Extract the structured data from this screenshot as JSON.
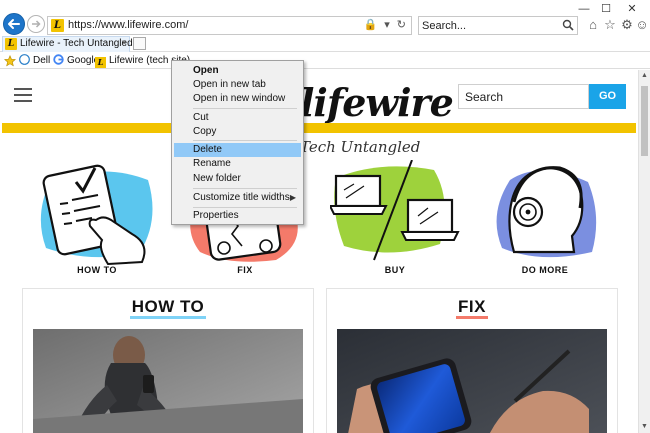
{
  "browser": {
    "url": "https://www.lifewire.com/",
    "search_placeholder": "Search...",
    "tab_title": "Lifewire - Tech Untangled",
    "tab_close": "×",
    "favicon_letter": "L",
    "window_controls": {
      "minimize": "—",
      "maximize": "☐",
      "close": "✕"
    },
    "url_icons": "🔒 ▾ ↻"
  },
  "favorites": [
    {
      "label": "Dell",
      "icon": "dell-icon"
    },
    {
      "label": "Google",
      "icon": "google-icon"
    },
    {
      "label": "Lifewire (tech site)",
      "icon": "lifewire-icon"
    }
  ],
  "page": {
    "logo": "lifewire",
    "tagline": "Tech Untangled",
    "search_placeholder": "Search",
    "go_label": "GO",
    "categories": [
      {
        "label": "HOW TO",
        "icon": "checklist-tablet-icon"
      },
      {
        "label": "FIX",
        "icon": "broken-phone-icon"
      },
      {
        "label": "BUY",
        "icon": "laptops-icon"
      },
      {
        "label": "DO MORE",
        "icon": "headphones-person-icon"
      }
    ],
    "cards": [
      {
        "title": "HOW TO",
        "underline_color": "#7fd3f7",
        "image": "runner-tying-shoe"
      },
      {
        "title": "FIX",
        "underline_color": "#f47a6a",
        "image": "hand-with-phone-stylus"
      }
    ]
  },
  "context_menu": {
    "items": [
      {
        "label": "Open",
        "bold": true
      },
      {
        "label": "Open in new tab"
      },
      {
        "label": "Open in new window"
      },
      {
        "label": "Cut"
      },
      {
        "label": "Copy"
      },
      {
        "label": "Delete",
        "highlighted": true
      },
      {
        "label": "Rename"
      },
      {
        "label": "New folder"
      },
      {
        "label": "Customize title widths",
        "submenu": true
      },
      {
        "label": "Properties"
      }
    ],
    "submenu_arrow": "▶"
  },
  "colors": {
    "accent_yellow": "#f2c300",
    "go_button": "#1aa4e8",
    "menu_highlight": "#91c9f7",
    "back_button": "#1e75c9"
  }
}
